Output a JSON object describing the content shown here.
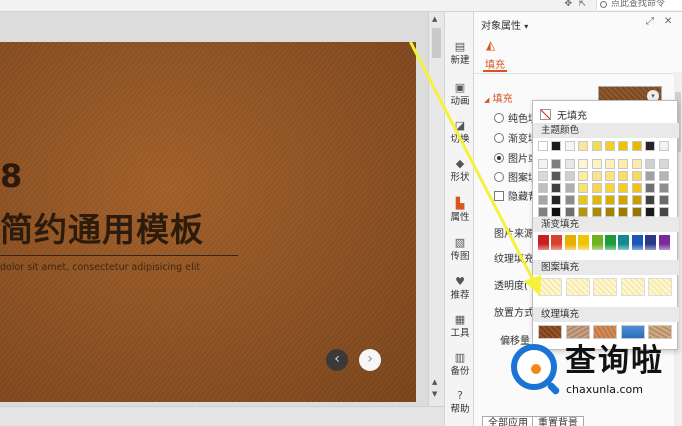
{
  "topbar": {
    "search_text": "点此查找命令"
  },
  "slide": {
    "number_text": "8",
    "title_text": "简约通用模板",
    "subtitle_text": "dolor sit amet, consectetur adipisicing elit",
    "prev_glyph": "‹",
    "next_glyph": "›"
  },
  "sidetools": [
    {
      "label": "新建",
      "icon": "new-slide-icon"
    },
    {
      "label": "动画",
      "icon": "animation-icon"
    },
    {
      "label": "切换",
      "icon": "transition-icon"
    },
    {
      "label": "形状",
      "icon": "shape-icon"
    },
    {
      "label": "属性",
      "icon": "property-icon"
    },
    {
      "label": "传图",
      "icon": "upload-image-icon"
    },
    {
      "label": "推荐",
      "icon": "recommend-icon"
    },
    {
      "label": "工具",
      "icon": "tools-icon"
    },
    {
      "label": "备份",
      "icon": "backup-icon"
    },
    {
      "label": "帮助",
      "icon": "help-icon"
    }
  ],
  "panel": {
    "title": "对象属性",
    "title_caret": "▾",
    "tab_fill": "填充",
    "section_fill": "填充",
    "section_caret": "◢",
    "radios": [
      {
        "label": "纯色填",
        "checked": false
      },
      {
        "label": "渐变填",
        "checked": false
      },
      {
        "label": "图片或",
        "checked": true
      },
      {
        "label": "图案填",
        "checked": false
      }
    ],
    "hide_background_label": "隐藏背",
    "image_source_label": "图片来源",
    "texture_fill_label": "纹理填充",
    "transparency_label": "透明度(",
    "placement_label": "放置方式",
    "offset_label": "偏移量",
    "apply_all_button": "全部应用",
    "reset_button": "重置背景"
  },
  "dropdown": {
    "no_fill_label": "无填充",
    "theme_colors_header": "主题颜色",
    "gradient_header": "渐变填充",
    "pattern_header": "图案填充",
    "texture_header": "纹理填充"
  },
  "colors": {
    "accent": "#d9541e",
    "annotation_arrow": "#f5f13a",
    "watermark_blue": "#1a74d6"
  },
  "watermark": {
    "cn_text": "查询啦",
    "url_text": "chaxunla.com"
  }
}
